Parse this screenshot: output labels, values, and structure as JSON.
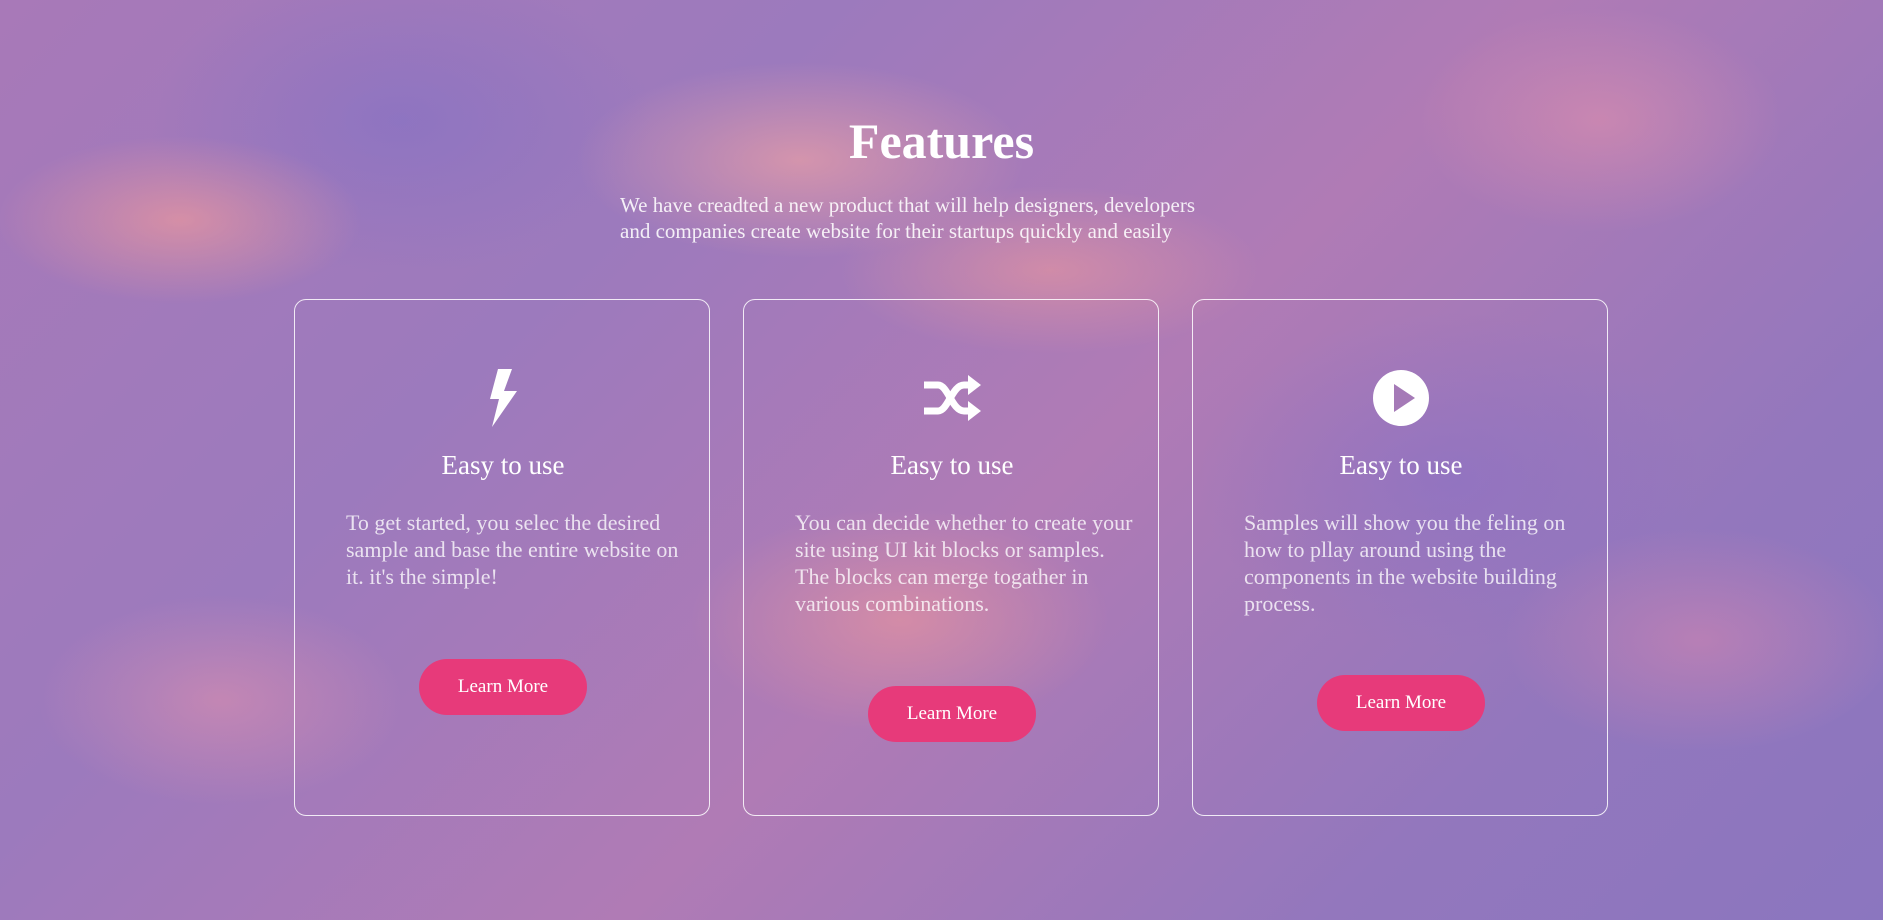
{
  "page": {
    "title": "Features",
    "subtitle_line1": "We have creadted a new product that will help designers, developers",
    "subtitle_line2": "and companies create website for their startups quickly and easily"
  },
  "colors": {
    "accent": "#e73a7a",
    "text": "#ffffff"
  },
  "cards": [
    {
      "icon": "lightning-bolt-icon",
      "title": "Easy to use",
      "text": "To get started, you selec the desired sample and base the entire website on it. it's the simple!",
      "button": "Learn More"
    },
    {
      "icon": "shuffle-icon",
      "title": "Easy to use",
      "text": "You can decide whether to create your site using UI kit blocks or samples. The blocks can merge togather in various combinations.",
      "button": "Learn More"
    },
    {
      "icon": "play-circle-icon",
      "title": "Easy to use",
      "text": "Samples will show you the feling on how to pllay around using the components in the website building process.",
      "button": "Learn More"
    }
  ]
}
